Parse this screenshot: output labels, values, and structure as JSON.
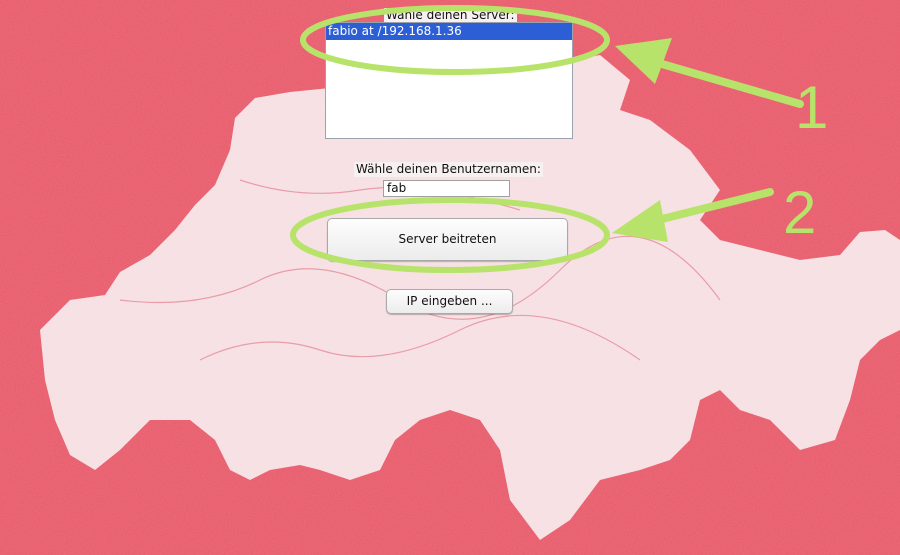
{
  "server_picker": {
    "label": "Wähle deinen Server:",
    "items": [
      "fabio at /192.168.1.36"
    ],
    "selected_index": 0
  },
  "username": {
    "label": "Wähle deinen Benutzernamen:",
    "value": "fab"
  },
  "buttons": {
    "join": "Server beitreten",
    "enter_ip": "IP eingeben ..."
  },
  "annotations": {
    "marker_1": "1",
    "marker_2": "2",
    "color": "#b7e36a"
  },
  "colors": {
    "background": "#e85a6a",
    "map_fill": "#f6dfe2",
    "selection": "#2c5fd5"
  }
}
